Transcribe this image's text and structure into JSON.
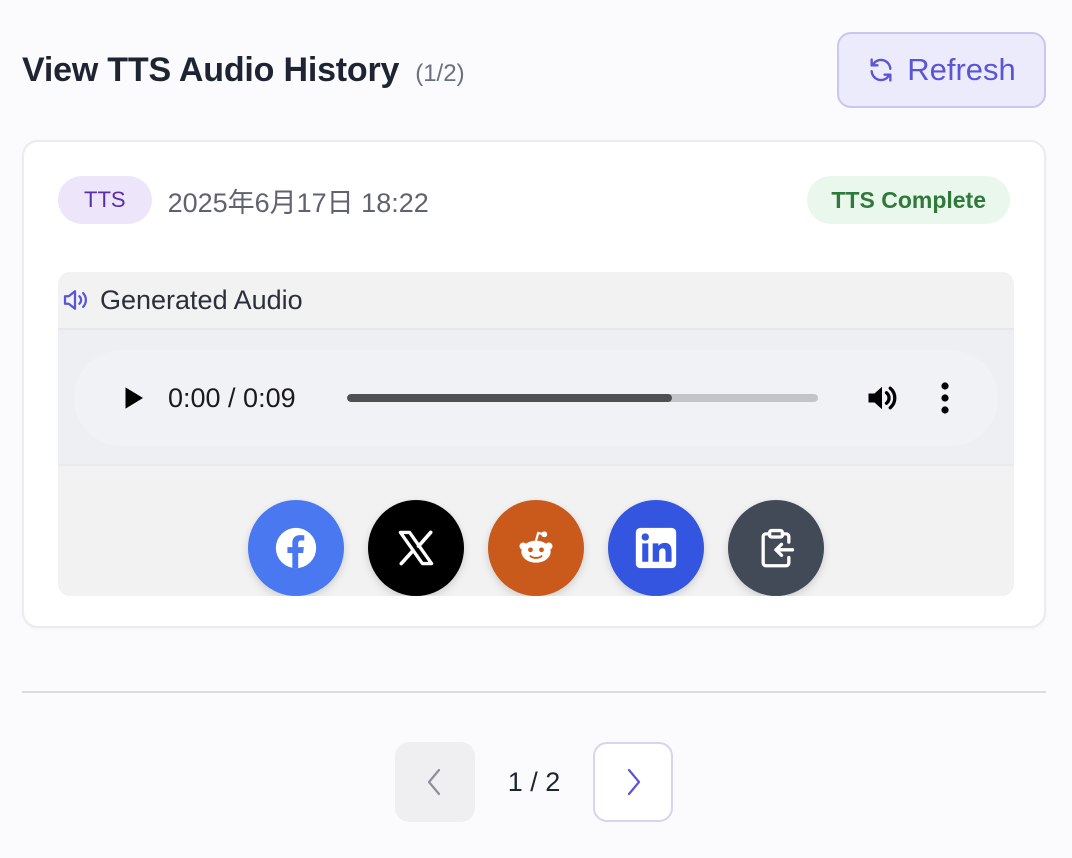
{
  "header": {
    "title": "View TTS Audio History",
    "count": "(1/2)",
    "refresh_label": "Refresh",
    "accent_color": "#5a55d6"
  },
  "entry": {
    "type_badge": "TTS",
    "timestamp": "2025年6月17日 18:22",
    "status": "TTS Complete",
    "section_title": "Generated Audio",
    "player": {
      "time": "0:00 / 0:09",
      "progress_fraction": 0.69
    },
    "share_buttons": [
      {
        "name": "facebook",
        "icon": "facebook-icon",
        "color": "#4a78f0"
      },
      {
        "name": "x",
        "icon": "x-icon",
        "color": "#000000"
      },
      {
        "name": "reddit",
        "icon": "reddit-icon",
        "color": "#c95a1b"
      },
      {
        "name": "linkedin",
        "icon": "linkedin-icon",
        "color": "#3355e0"
      },
      {
        "name": "copy",
        "icon": "clipboard-icon",
        "color": "#434a57"
      }
    ]
  },
  "pagination": {
    "indicator": "1 / 2"
  }
}
